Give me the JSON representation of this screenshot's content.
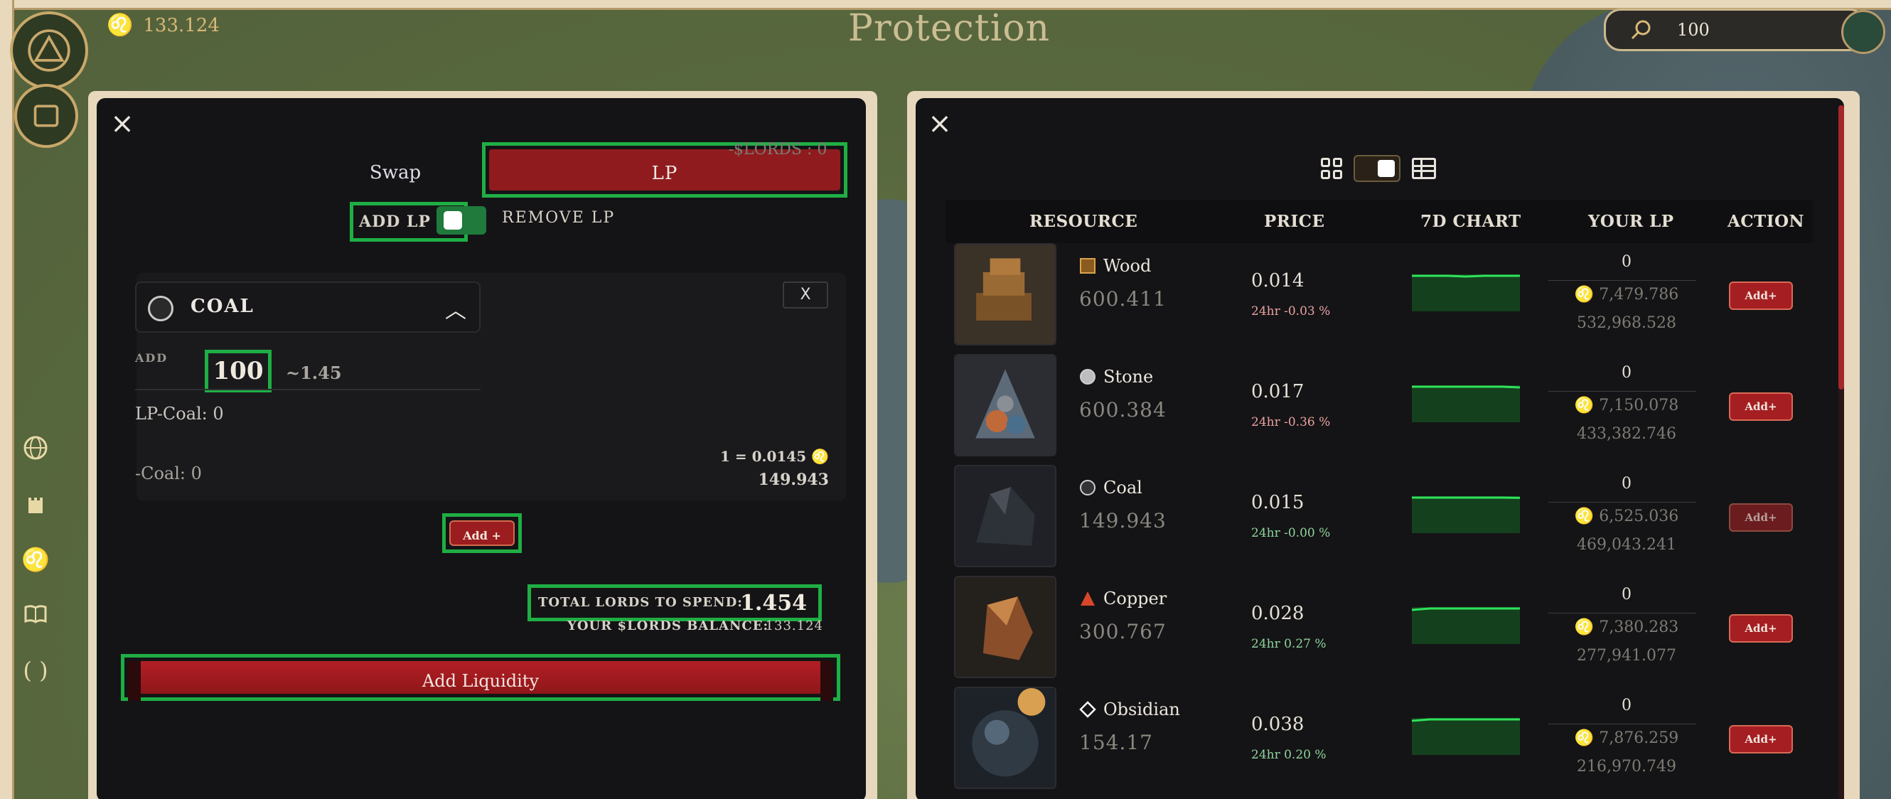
{
  "header": {
    "lords_balance": "133.124",
    "title": "Protection",
    "search_value": "100"
  },
  "left_panel": {
    "tabs": {
      "swap": "Swap",
      "lp": "LP"
    },
    "add_lp_label": "ADD LP",
    "remove_lp_label": "REMOVE LP",
    "resource_name": "COAL",
    "clear_label": "X",
    "add_label": "ADD",
    "amount": "100",
    "approx_lords": "~1.45",
    "lp_coal": "LP-Coal: 0",
    "lp_lords": "-$LORDS : 0",
    "lp_coal_qty": "-Coal: 0",
    "rate": "1 = 0.0145",
    "resource_balance": "149.943",
    "add_button": "Add +",
    "total_label": "TOTAL LORDS TO SPEND:",
    "total_value": "1.454",
    "balance_label": "YOUR $LORDS BALANCE:",
    "balance_value": "133.124",
    "add_liquidity_button": "Add Liquidity"
  },
  "right_panel": {
    "columns": [
      "RESOURCE",
      "PRICE",
      "7D CHART",
      "YOUR LP",
      "ACTION"
    ],
    "rows": [
      {
        "name": "Wood",
        "amount": "600.411",
        "price": "0.014",
        "change": "24hr -0.03 %",
        "trend": "neg",
        "your_lp": "0",
        "lp_lords": "7,479.786",
        "lp_total": "532,968.528",
        "action": "Add+",
        "icon_color": "#8a5a1e",
        "chart": [
          0.6,
          0.6,
          0.6,
          0.55,
          0.6,
          0.6,
          0.6
        ]
      },
      {
        "name": "Stone",
        "amount": "600.384",
        "price": "0.017",
        "change": "24hr -0.36 %",
        "trend": "neg",
        "your_lp": "0",
        "lp_lords": "7,150.078",
        "lp_total": "433,382.746",
        "action": "Add+",
        "icon_color": "#bdbdbd",
        "chart": [
          0.6,
          0.6,
          0.6,
          0.6,
          0.6,
          0.6,
          0.55
        ]
      },
      {
        "name": "Coal",
        "amount": "149.943",
        "price": "0.015",
        "change": "24hr -0.00 %",
        "trend": "pos",
        "your_lp": "0",
        "lp_lords": "6,525.036",
        "lp_total": "469,043.241",
        "action": "Add+",
        "icon_color": "#333333",
        "chart": [
          0.6,
          0.6,
          0.6,
          0.6,
          0.6,
          0.6,
          0.58
        ]
      },
      {
        "name": "Copper",
        "amount": "300.767",
        "price": "0.028",
        "change": "24hr 0.27 %",
        "trend": "pos",
        "your_lp": "0",
        "lp_lords": "7,380.283",
        "lp_total": "277,941.077",
        "action": "Add+",
        "icon_color": "#d9472b",
        "chart": [
          0.5,
          0.6,
          0.6,
          0.6,
          0.6,
          0.6,
          0.6
        ]
      },
      {
        "name": "Obsidian",
        "amount": "154.17",
        "price": "0.038",
        "change": "24hr 0.20 %",
        "trend": "pos",
        "your_lp": "0",
        "lp_lords": "7,876.259",
        "lp_total": "216,970.749",
        "action": "Add+",
        "icon_color": "#ffffff",
        "chart": [
          0.5,
          0.6,
          0.6,
          0.6,
          0.6,
          0.6,
          0.6
        ]
      }
    ]
  },
  "colors": {
    "accent_red": "#8f1b1e",
    "highlight_green": "#1fae44",
    "panel_bg": "#141416"
  }
}
